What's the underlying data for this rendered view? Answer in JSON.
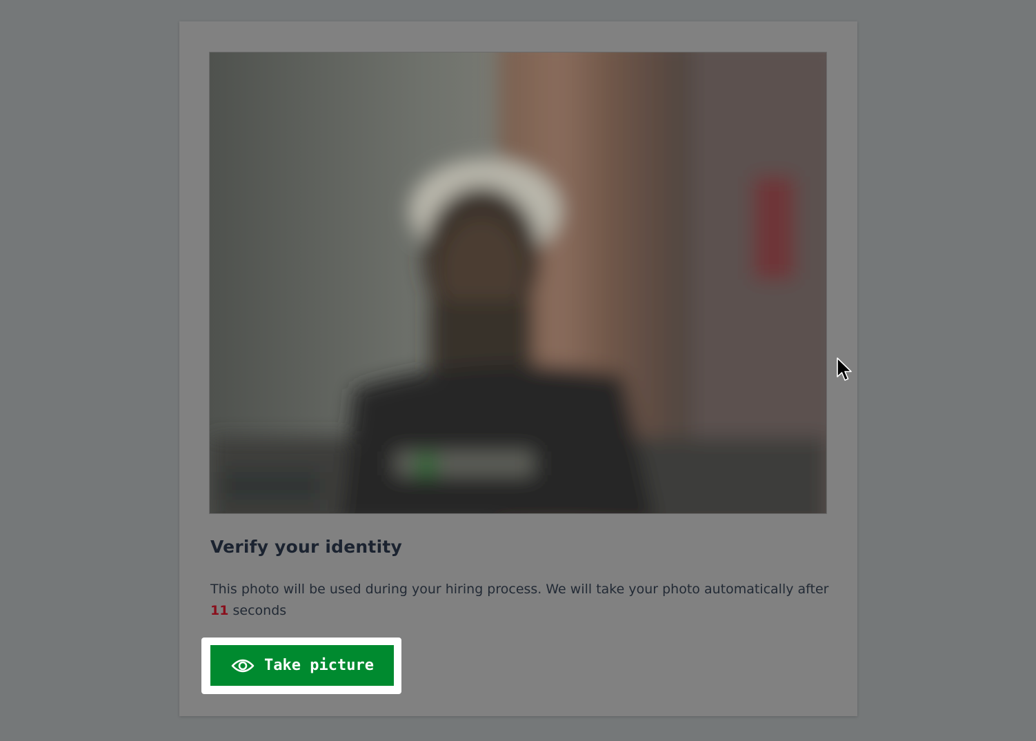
{
  "verification": {
    "heading": "Verify your identity",
    "description_before": "This photo will be used during your hiring process. We will take your photo automatically after ",
    "countdown_seconds": "11",
    "description_after": " seconds"
  },
  "actions": {
    "take_picture_label": "Take picture",
    "take_picture_icon": "eye-icon"
  },
  "colors": {
    "backdrop": "#757879",
    "card": "#818181",
    "primary_button": "#008a2f",
    "countdown": "#8a0f1c",
    "heading": "#1b2330"
  }
}
